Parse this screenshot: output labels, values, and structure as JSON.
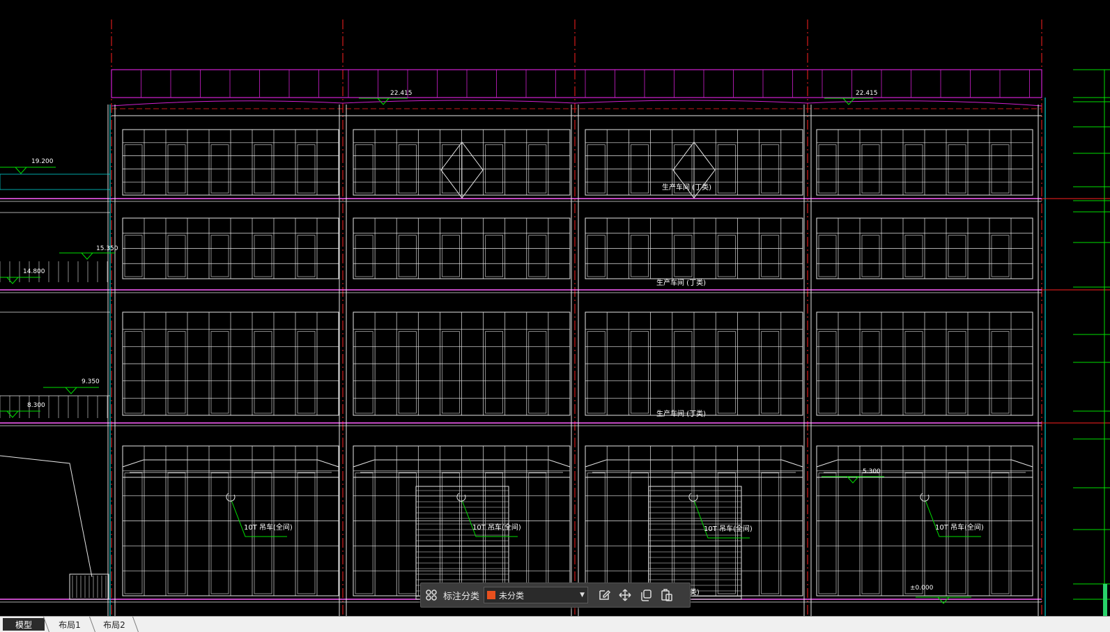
{
  "drawing": {
    "floor_labels": [
      "生产车间 (丁类)",
      "生产车间 (丁类)",
      "生产车间 (丁类)",
      "(丁类)"
    ],
    "crane_labels": [
      "10T 吊车(全间)",
      "10T 吊车(全间)",
      "10T 吊车(全间)",
      "10T 吊车(全间)"
    ],
    "elevations": {
      "roof_left": "22.415",
      "roof_right": "22.415",
      "left_top": "19.200",
      "left_mid1": "15.350",
      "left_mid2": "14.800",
      "left_mid3": "9.350",
      "left_mid4": "8.300",
      "right_low": "5.300",
      "ground": "±0.000"
    }
  },
  "toolbar": {
    "label": "标注分类",
    "category_value": "未分类",
    "category_color": "#e8501e",
    "icons": [
      "grid-icon",
      "edit-icon",
      "move-icon",
      "copy-icon",
      "paste-icon"
    ]
  },
  "tabs": [
    "模型",
    "布局1",
    "布局2"
  ],
  "colors": {
    "background": "#000000",
    "wall": "#ffffff",
    "axis": "#ff2020",
    "parapet": "#d020d0",
    "annotation": "#00e000",
    "edge": "#00d0d0",
    "slab": "#ff60ff"
  }
}
